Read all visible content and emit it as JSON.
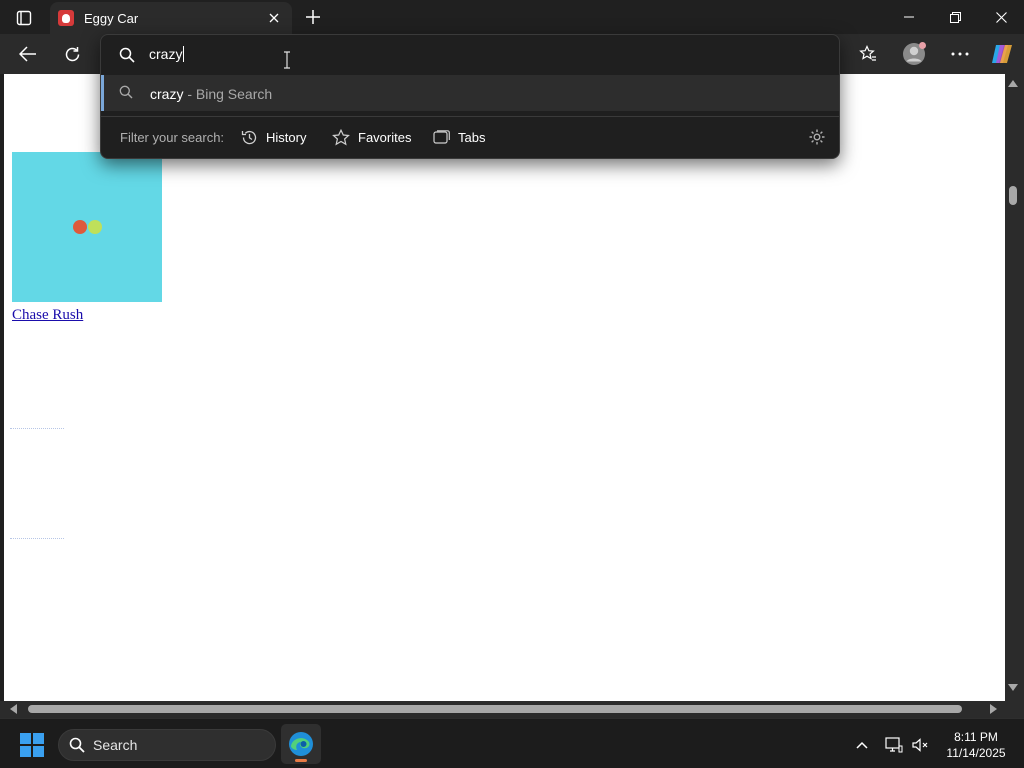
{
  "browser": {
    "tab": {
      "title": "Eggy Car"
    },
    "address": {
      "value": "crazy"
    }
  },
  "omnibox": {
    "suggestion": {
      "query": "crazy",
      "suffix": "- Bing Search"
    },
    "filter": {
      "label": "Filter your search:",
      "chips": [
        "History",
        "Favorites",
        "Tabs"
      ]
    }
  },
  "page": {
    "game_link": "Chase Rush",
    "thumb_colors": {
      "background": "#63d8e6",
      "dot1": "#de5a3c",
      "dot2": "#bfe05a"
    }
  },
  "taskbar": {
    "search_label": "Search",
    "time": "8:11 PM",
    "date": "11/14/2025"
  },
  "colors": {
    "chrome": "#202020",
    "toolbar": "#2b2b2b",
    "link": "#1a0dab",
    "accent": "#7aa7d9"
  }
}
